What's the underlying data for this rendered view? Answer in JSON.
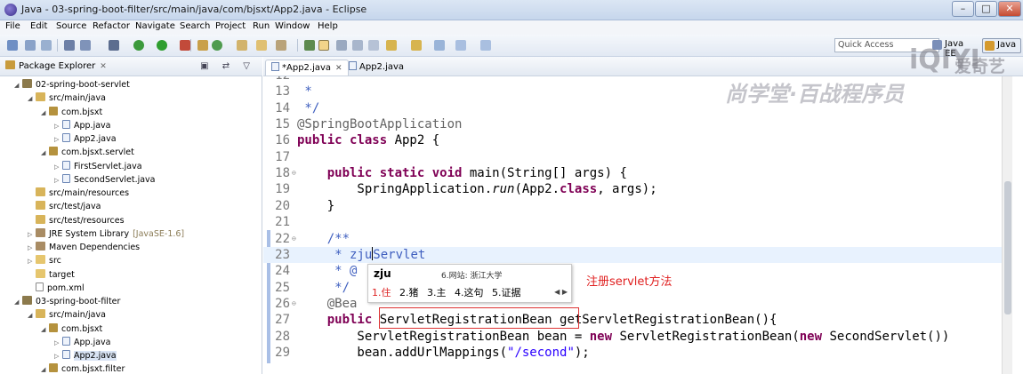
{
  "window": {
    "title": "Java - 03-spring-boot-filter/src/main/java/com/bjsxt/App2.java - Eclipse",
    "minimize": "–",
    "maximize": "□",
    "close": "✕"
  },
  "menu": [
    "File",
    "Edit",
    "Source",
    "Refactor",
    "Navigate",
    "Search",
    "Project",
    "Run",
    "Window",
    "Help"
  ],
  "toolbar": {
    "quick_access_placeholder": "Quick Access",
    "perspectives": [
      "Java EE",
      "Java"
    ]
  },
  "package_explorer": {
    "title": "Package Explorer",
    "close": "✕",
    "tools": "▣ ⇄ ▽",
    "tree": [
      {
        "label": "02-spring-boot-servlet",
        "icon": "project-icon",
        "arrow": "◢",
        "depth": 0
      },
      {
        "label": "src/main/java",
        "icon": "source-folder-icon",
        "arrow": "◢",
        "depth": 1
      },
      {
        "label": "com.bjsxt",
        "icon": "package-icon",
        "arrow": "◢",
        "depth": 2
      },
      {
        "label": "App.java",
        "icon": "java-file-icon",
        "arrow": "▷",
        "depth": 3
      },
      {
        "label": "App2.java",
        "icon": "java-file-icon",
        "arrow": "▷",
        "depth": 3
      },
      {
        "label": "com.bjsxt.servlet",
        "icon": "package-icon",
        "arrow": "◢",
        "depth": 2
      },
      {
        "label": "FirstServlet.java",
        "icon": "java-file-icon",
        "arrow": "▷",
        "depth": 3
      },
      {
        "label": "SecondServlet.java",
        "icon": "java-file-icon",
        "arrow": "▷",
        "depth": 3
      },
      {
        "label": "src/main/resources",
        "icon": "source-folder-icon",
        "arrow": "",
        "depth": 1
      },
      {
        "label": "src/test/java",
        "icon": "source-folder-icon",
        "arrow": "",
        "depth": 1
      },
      {
        "label": "src/test/resources",
        "icon": "source-folder-icon",
        "arrow": "",
        "depth": 1
      },
      {
        "label": "JRE System Library",
        "decor": "[JavaSE-1.6]",
        "icon": "library-icon",
        "arrow": "▷",
        "depth": 1
      },
      {
        "label": "Maven Dependencies",
        "icon": "library-icon",
        "arrow": "▷",
        "depth": 1
      },
      {
        "label": "src",
        "icon": "folder-icon",
        "arrow": "▷",
        "depth": 1
      },
      {
        "label": "target",
        "icon": "folder-icon",
        "arrow": "",
        "depth": 1
      },
      {
        "label": "pom.xml",
        "icon": "pom-file-icon",
        "arrow": "",
        "depth": 1
      },
      {
        "label": "03-spring-boot-filter",
        "icon": "project-icon",
        "arrow": "◢",
        "depth": 0
      },
      {
        "label": "src/main/java",
        "icon": "source-folder-icon",
        "arrow": "◢",
        "depth": 1
      },
      {
        "label": "com.bjsxt",
        "icon": "package-icon",
        "arrow": "◢",
        "depth": 2
      },
      {
        "label": "App.java",
        "icon": "java-file-icon",
        "arrow": "▷",
        "depth": 3
      },
      {
        "label": "App2.java",
        "icon": "java-file-icon",
        "arrow": "▷",
        "depth": 3,
        "selected": true
      },
      {
        "label": "com.bjsxt.filter",
        "icon": "package-icon",
        "arrow": "◢",
        "depth": 2
      }
    ]
  },
  "editor": {
    "tabs": [
      {
        "label": "*App2.java",
        "active": true,
        "close": "✕"
      },
      {
        "label": "App2.java",
        "active": false
      }
    ],
    "lines": [
      {
        "n": "12",
        "segs": []
      },
      {
        "n": "13",
        "segs": [
          {
            "t": " *",
            "c": "cm"
          }
        ]
      },
      {
        "n": "14",
        "segs": [
          {
            "t": " */",
            "c": "cm"
          }
        ]
      },
      {
        "n": "15",
        "segs": [
          {
            "t": "@SpringBootApplication",
            "c": "an"
          }
        ]
      },
      {
        "n": "16",
        "segs": [
          {
            "t": "public class ",
            "c": "kw"
          },
          {
            "t": "App2 {",
            "c": ""
          }
        ]
      },
      {
        "n": "17",
        "segs": []
      },
      {
        "n": "18",
        "fold": true,
        "segs": [
          {
            "t": "    "
          },
          {
            "t": "public static void ",
            "c": "kw"
          },
          {
            "t": "main(String[] args) {"
          }
        ]
      },
      {
        "n": "19",
        "segs": [
          {
            "t": "        SpringApplication."
          },
          {
            "t": "run",
            "c": "it"
          },
          {
            "t": "(App2."
          },
          {
            "t": "class",
            "c": "kw"
          },
          {
            "t": ", args);"
          }
        ]
      },
      {
        "n": "20",
        "segs": [
          {
            "t": "    }"
          }
        ]
      },
      {
        "n": "21",
        "segs": []
      },
      {
        "n": "22",
        "fold": true,
        "segs": [
          {
            "t": "    /**",
            "c": "cm"
          }
        ]
      },
      {
        "n": "23",
        "current": true,
        "segs": [
          {
            "t": "     * zju",
            "c": "cm"
          },
          {
            "caret": true
          },
          {
            "t": "Servlet",
            "c": "cm"
          }
        ]
      },
      {
        "n": "24",
        "segs": [
          {
            "t": "     * @",
            "c": "cm"
          }
        ]
      },
      {
        "n": "25",
        "segs": [
          {
            "t": "     */",
            "c": "cm"
          }
        ]
      },
      {
        "n": "26",
        "fold": true,
        "segs": [
          {
            "t": "    @Bea",
            "c": "an"
          }
        ]
      },
      {
        "n": "27",
        "segs": [
          {
            "t": "    "
          },
          {
            "t": "public",
            "c": "kw"
          },
          {
            "t": " ServletRegistrationBean getServletRegistrationBean(){"
          }
        ]
      },
      {
        "n": "28",
        "segs": [
          {
            "t": "        ServletRegistrationBean bean = "
          },
          {
            "t": "new",
            "c": "kw"
          },
          {
            "t": " ServletRegistrationBean("
          },
          {
            "t": "new",
            "c": "kw"
          },
          {
            "t": " SecondServlet()"
          },
          {
            "t": ")"
          }
        ]
      },
      {
        "n": "29",
        "segs": [
          {
            "t": "        bean.addUrlMappings("
          },
          {
            "t": "\"/second\"",
            "c": "str"
          },
          {
            "t": ");"
          }
        ]
      }
    ]
  },
  "ime": {
    "input": "zju",
    "hint": "6.网站: 浙江大学",
    "candidates": [
      "1.住",
      "2.猪",
      "3.主",
      "4.这句",
      "5.证据"
    ],
    "nav": "◀ ▶"
  },
  "annotation": {
    "text": "注册servlet方法"
  },
  "watermark": {
    "logo": "iQIYI",
    "brand": "爱奇艺",
    "school": "尚学堂·百战程序员"
  }
}
